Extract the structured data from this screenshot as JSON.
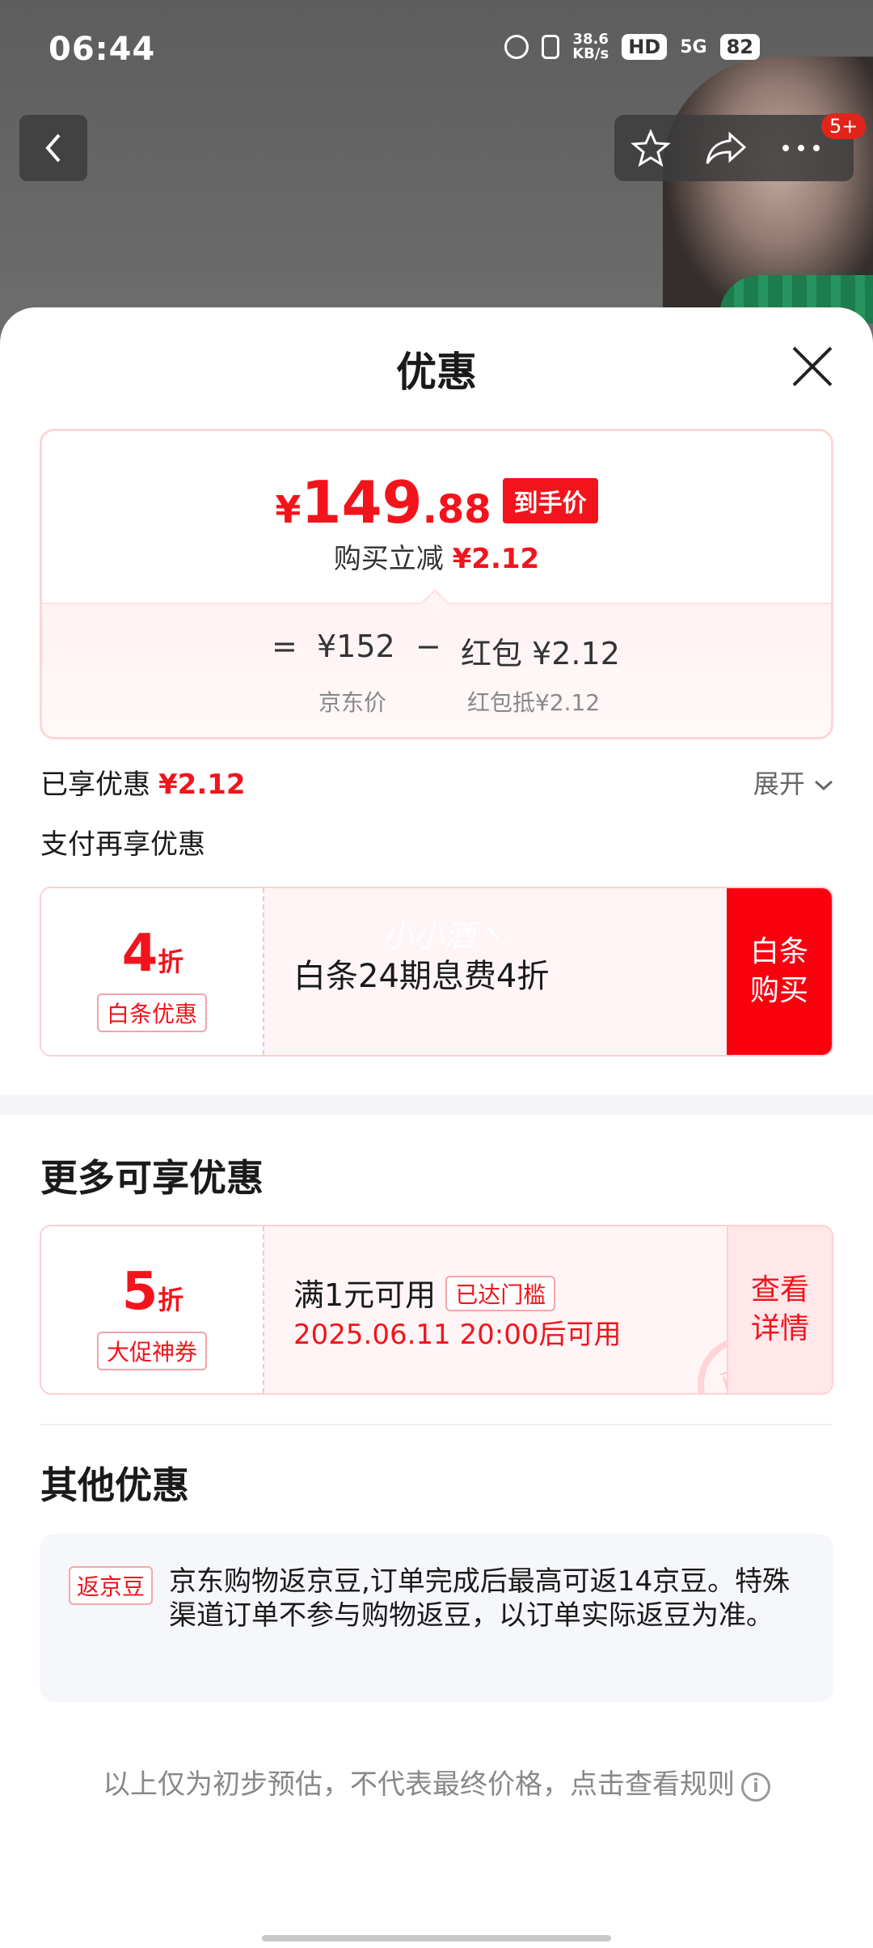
{
  "status_bar": {
    "time": "06:44",
    "speed_top": "38.6",
    "speed_unit": "KB/s",
    "hd": "HD",
    "network": "5G",
    "battery": "82"
  },
  "nav": {
    "badge": "5+"
  },
  "sheet": {
    "title": "优惠"
  },
  "price": {
    "yen": "¥",
    "integer": "149",
    "decimal": ".88",
    "tag": "到手价",
    "instant_reduce_label": "购买立减",
    "instant_reduce_value": "¥2.12",
    "eq": "=",
    "jd_price": "¥152",
    "minus": "−",
    "red_packet": "红包 ¥2.12",
    "jd_price_label": "京东价",
    "red_packet_label": "红包抵¥2.12"
  },
  "enjoyed": {
    "label": "已享优惠",
    "value": "¥2.12",
    "expand": "展开"
  },
  "pay_more": "支付再享优惠",
  "baitiao_coupon": {
    "discount_num": "4",
    "discount_unit": "折",
    "tag": "白条优惠",
    "desc": "白条24期息费4折",
    "watermark": "小小酒丶",
    "action": "白条\n购买"
  },
  "more_title": "更多可享优惠",
  "promo_coupon": {
    "discount_num": "5",
    "discount_unit": "折",
    "tag": "大促神券",
    "threshold": "满1元可用",
    "reached": "已达门槛",
    "valid": "2025.06.11 20:00后可用",
    "stamp": "已领",
    "action": "查看\n详情"
  },
  "other_title": "其他优惠",
  "bean": {
    "tag": "返京豆",
    "text": "京东购物返京豆,订单完成后最高可返14京豆。特殊渠道订单不参与购物返豆，以订单实际返豆为准。"
  },
  "footer": {
    "note": "以上仅为初步预估，不代表最终价格，点击查看规则"
  },
  "colors": {
    "brand_red": "#f2141c",
    "action_red": "#f9000f"
  }
}
